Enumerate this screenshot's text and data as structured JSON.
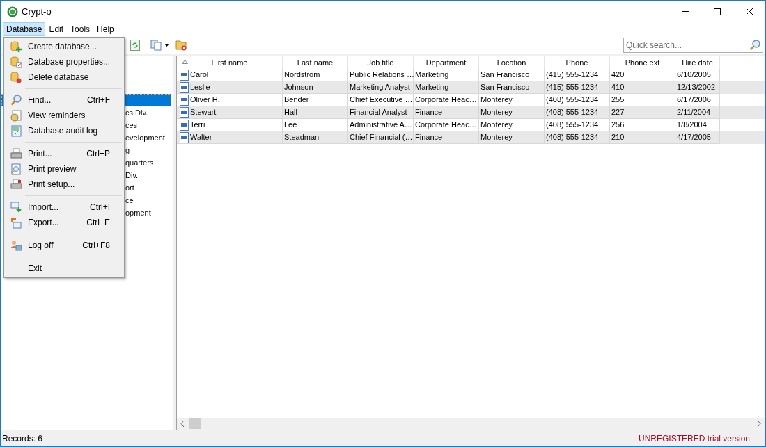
{
  "window": {
    "title": "Crypt-o"
  },
  "menubar": [
    {
      "label": "Database",
      "selected": true
    },
    {
      "label": "Edit",
      "selected": false
    },
    {
      "label": "Tools",
      "selected": false
    },
    {
      "label": "Help",
      "selected": false
    }
  ],
  "menu": [
    {
      "kind": "item",
      "label": "Create database..."
    },
    {
      "kind": "item",
      "label": "Database properties..."
    },
    {
      "kind": "item",
      "label": "Delete database"
    },
    {
      "kind": "separator"
    },
    {
      "kind": "item",
      "label": "Find...",
      "shortcut": "Ctrl+F"
    },
    {
      "kind": "item",
      "label": "View reminders"
    },
    {
      "kind": "item",
      "label": "Database audit log"
    },
    {
      "kind": "separator"
    },
    {
      "kind": "item",
      "label": "Print...",
      "shortcut": "Ctrl+P"
    },
    {
      "kind": "item",
      "label": "Print preview"
    },
    {
      "kind": "item",
      "label": "Print setup..."
    },
    {
      "kind": "separator"
    },
    {
      "kind": "item",
      "label": "Import...",
      "shortcut": "Ctrl+I"
    },
    {
      "kind": "item",
      "label": "Export...",
      "shortcut": "Ctrl+E"
    },
    {
      "kind": "separator"
    },
    {
      "kind": "item",
      "label": "Log off",
      "shortcut": "Ctrl+F8"
    },
    {
      "kind": "separator"
    },
    {
      "kind": "item",
      "label": "Exit"
    }
  ],
  "search": {
    "placeholder": "Quick search..."
  },
  "tree": [
    {
      "selected": true
    },
    {
      "label": "cs Div.",
      "selected": false
    },
    {
      "label": "ces",
      "selected": false
    },
    {
      "label": "evelopment",
      "selected": false
    },
    {
      "label": "g",
      "selected": false
    },
    {
      "label": "quarters",
      "selected": false
    },
    {
      "label": "Div.",
      "selected": false
    },
    {
      "label": "ort",
      "selected": false
    },
    {
      "label": "ce",
      "selected": false
    },
    {
      "label": "opment",
      "selected": false
    }
  ],
  "table": {
    "columns": [
      {
        "label": "First name",
        "sorted": true
      },
      {
        "label": "Last name",
        "sorted": false
      },
      {
        "label": "Job title",
        "sorted": false
      },
      {
        "label": "Department",
        "sorted": false
      },
      {
        "label": "Location",
        "sorted": false
      },
      {
        "label": "Phone",
        "sorted": false
      },
      {
        "label": "Phone ext",
        "sorted": false
      },
      {
        "label": "Hire date",
        "sorted": false
      }
    ],
    "rows": [
      [
        "Carol",
        "Nordstrom",
        "Public Relations …",
        "Marketing",
        "San Francisco",
        "(415) 555-1234",
        "420",
        "6/10/2005"
      ],
      [
        "Leslie",
        "Johnson",
        "Marketing Analyst",
        "Marketing",
        "San Francisco",
        "(415) 555-1234",
        "410",
        "12/13/2002"
      ],
      [
        "Oliver H.",
        "Bender",
        "Chief Executive …",
        "Corporate Heac…",
        "Monterey",
        "(408) 555-1234",
        "255",
        "6/17/2006"
      ],
      [
        "Stewart",
        "Hall",
        "Financial Analyst",
        "Finance",
        "Monterey",
        "(408) 555-1234",
        "227",
        "2/11/2004"
      ],
      [
        "Terri",
        "Lee",
        "Administrative A…",
        "Corporate Heac…",
        "Monterey",
        "(408) 555-1234",
        "256",
        "1/8/2004"
      ],
      [
        "Walter",
        "Steadman",
        "Chief Financial (…",
        "Finance",
        "Monterey",
        "(408) 555-1234",
        "210",
        "4/17/2005"
      ]
    ]
  },
  "status_bar": {
    "records": "Records: 6",
    "license": "UNREGISTERED trial version"
  }
}
